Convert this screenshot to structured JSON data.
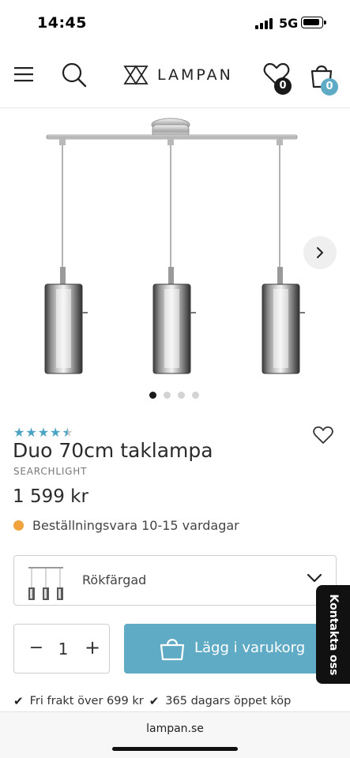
{
  "status_bar": {
    "time": "14:45",
    "network": "5G",
    "signal_icon": "signal-bars-icon",
    "battery_icon": "battery-icon"
  },
  "header": {
    "menu_icon": "hamburger-menu-icon",
    "search_icon": "search-icon",
    "logo_text": "LAMPAN",
    "wishlist_icon": "heart-icon",
    "wishlist_count": "0",
    "cart_icon": "shopping-bag-icon",
    "cart_count": "0"
  },
  "gallery": {
    "image_name": "three-pendant-ceiling-lamp",
    "next_icon": "chevron-right-icon",
    "slides": 4,
    "active_slide": 1
  },
  "product": {
    "rating": 4.5,
    "rating_max": 5,
    "title": "Duo 70cm taklampa",
    "brand": "SEARCHLIGHT",
    "price": "1 599 kr",
    "stock_text": "Beställningsvara 10-15 vardagar",
    "stock_color": "#f0a33d"
  },
  "variant": {
    "selected": "Rökfärgad",
    "chevron_icon": "chevron-down-icon"
  },
  "purchase": {
    "minus": "−",
    "quantity": "1",
    "plus": "+",
    "add_to_cart": "Lägg i varukorg",
    "button_color": "#5faac5"
  },
  "contact_tab": {
    "label": "Kontakta oss"
  },
  "usps": [
    {
      "text": "Fri frakt över 699 kr"
    },
    {
      "text": "365 dagars öppet köp"
    }
  ],
  "browser": {
    "url": "lampan.se"
  },
  "colors": {
    "accent": "#4aa3c3",
    "badge_dark": "#1a1a1a",
    "badge_blue": "#5faac5"
  }
}
